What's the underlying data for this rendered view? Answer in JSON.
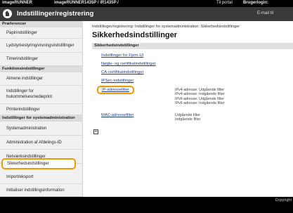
{
  "topbar": {
    "brand": "imageRUNNER",
    "model": "imageRUNNER1435P / iR1435P /",
    "portal": "Til portal",
    "user": "Brugerlogin:"
  },
  "header": {
    "title": "Indstillinger/registrering",
    "email": "E-mail til"
  },
  "sidebar": {
    "sections": [
      {
        "heading": "Præferencer",
        "items": [
          "Papirindstillinger",
          "Lydstyrkestyring/visningsindstillinger",
          "Timerindstillinger"
        ]
      },
      {
        "heading": "Funktionsindstillinger",
        "items": [
          "Almene indstillinger",
          "Indstillinger for hukommelsesmedieprint",
          "Printerindstillinger"
        ]
      },
      {
        "heading": "Indstillinger for systemadministration",
        "items": [
          "Systemadministration",
          "Administration af Afdelings-ID",
          "Netværksindstillinger",
          "Sikkerhedsindstillinger",
          "Import/eksport",
          "Initialiser indstillingsinformation"
        ]
      }
    ]
  },
  "main": {
    "breadcrumb": "Indstillinger/registrering: Indstillinger for systemadministration: Sikkerhedsindstillinger",
    "title": "Sikkerhedsindstillinger",
    "section_heading": "Sikkerhedsindstillinger",
    "links": [
      "Indstillinger for Fjern-UI",
      "Nøgle- og certifikatindstillinger",
      "CA-certifikatindstillinger",
      "IPSec-indstillinger",
      "IP-adressefilter",
      "MAC-adressefilter"
    ],
    "ip_filter_info": [
      "IPv4-adresse: Udgående filter",
      "IPv4-adresse: Indgående filter",
      "IPv6-adresse: Udgående filter",
      "IPv6-adresse: Indgående filter"
    ],
    "mac_filter_info": [
      "Udgående filter",
      "Indgående filter"
    ]
  },
  "footer": {
    "copyright": "Copyright"
  },
  "colors": {
    "highlight": "#f39800",
    "link": "#1a3c8e",
    "header_bg": "#3a3a3a"
  },
  "icons": {
    "home": "home-icon",
    "menu": "menu-icon"
  }
}
